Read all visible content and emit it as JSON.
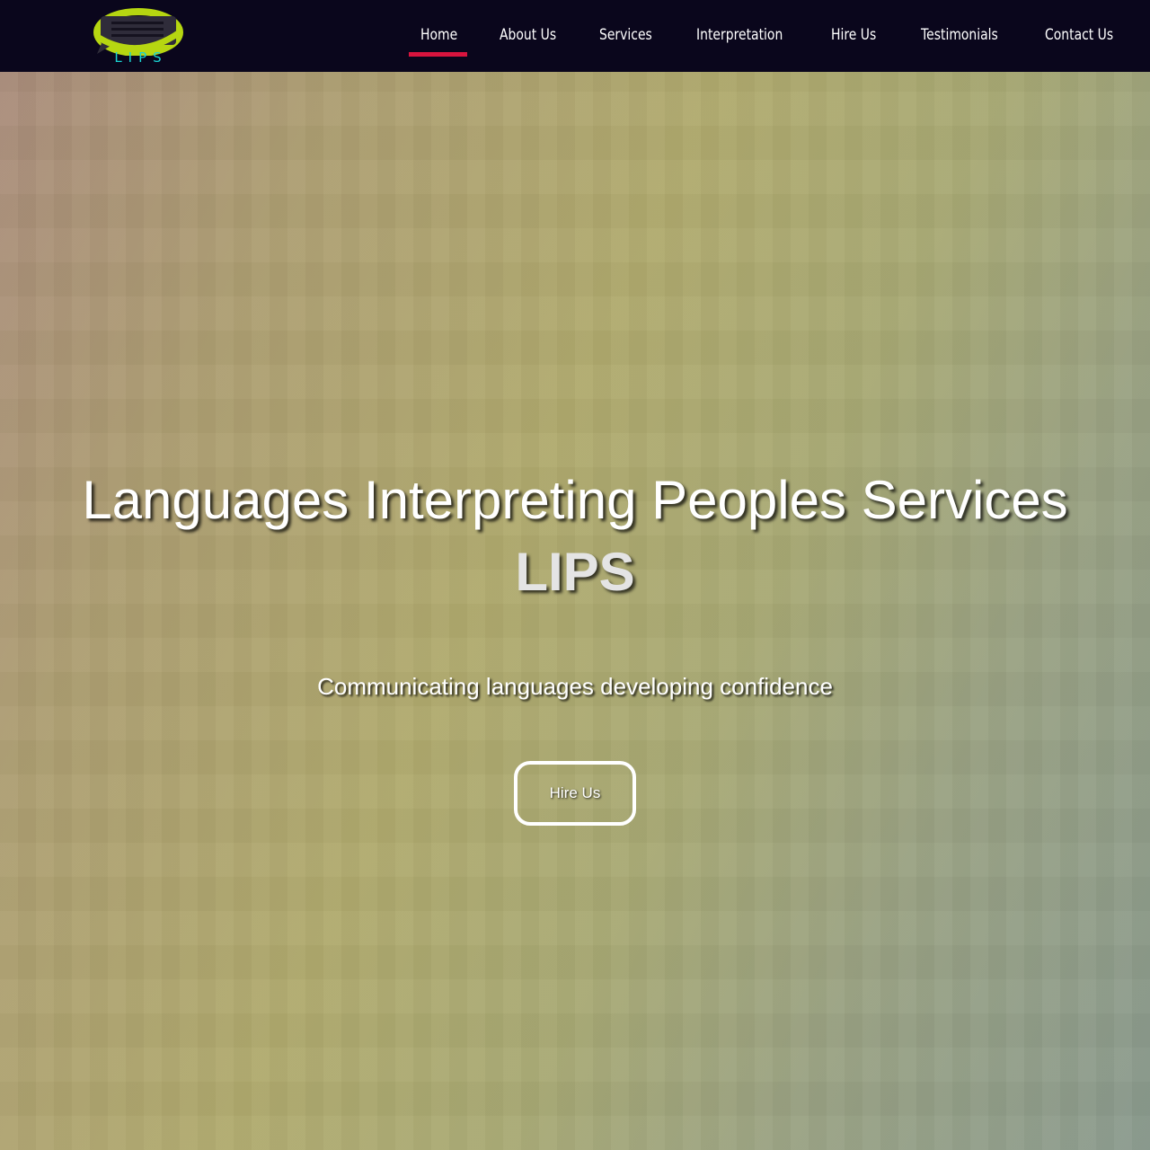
{
  "brand": {
    "logo_text": "LIPS",
    "logo_icon": "speech-bubble-icon",
    "colors": {
      "ring": "#b6d611",
      "bubble": "#2f2c3a",
      "text": "#19d3d3"
    }
  },
  "nav": {
    "active_index": 0,
    "active_color": "#d8143e",
    "items": [
      {
        "label": "Home"
      },
      {
        "label": "About Us"
      },
      {
        "label": "Services"
      },
      {
        "label": "Interpretation"
      },
      {
        "label": "Hire Us"
      },
      {
        "label": "Testimonials"
      },
      {
        "label": "Contact Us"
      }
    ]
  },
  "hero": {
    "title": "Languages Interpreting Peoples Services",
    "brand": "LIPS",
    "subtitle": "Communicating languages developing confidence",
    "cta_label": "Hire Us"
  },
  "colors": {
    "navbar_bg": "#0a061c",
    "hero_gradient": [
      "#a98a7c",
      "#b0aa6e",
      "#8a9a8e"
    ]
  }
}
